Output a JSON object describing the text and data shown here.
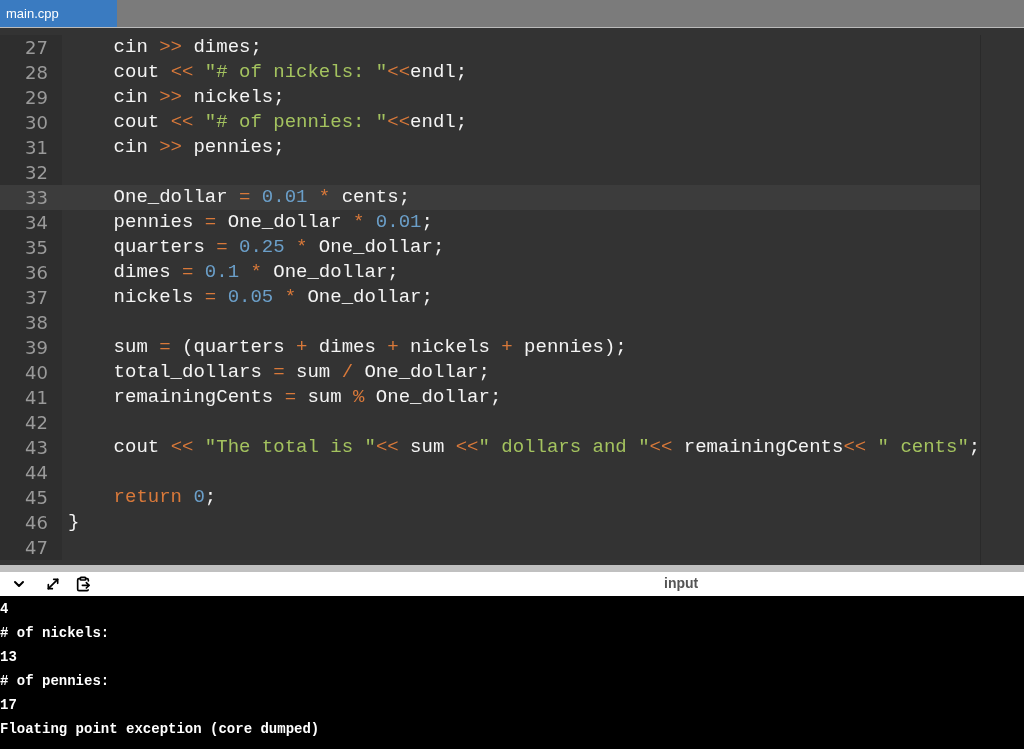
{
  "tabs": [
    {
      "label": "main.cpp",
      "selected": true
    }
  ],
  "code_lines": [
    {
      "number": "27",
      "highlighted": false,
      "tokens": [
        {
          "kind": "plain",
          "text": "    cin "
        },
        {
          "kind": "op",
          "text": ">>"
        },
        {
          "kind": "plain",
          "text": " dimes;"
        }
      ]
    },
    {
      "number": "28",
      "highlighted": false,
      "tokens": [
        {
          "kind": "plain",
          "text": "    cout "
        },
        {
          "kind": "op",
          "text": "<<"
        },
        {
          "kind": "str",
          "text": " \"# of nickels: \""
        },
        {
          "kind": "op",
          "text": "<<"
        },
        {
          "kind": "plain",
          "text": "endl;"
        }
      ]
    },
    {
      "number": "29",
      "highlighted": false,
      "tokens": [
        {
          "kind": "plain",
          "text": "    cin "
        },
        {
          "kind": "op",
          "text": ">>"
        },
        {
          "kind": "plain",
          "text": " nickels;"
        }
      ]
    },
    {
      "number": "30",
      "highlighted": false,
      "tokens": [
        {
          "kind": "plain",
          "text": "    cout "
        },
        {
          "kind": "op",
          "text": "<<"
        },
        {
          "kind": "str",
          "text": " \"# of pennies: \""
        },
        {
          "kind": "op",
          "text": "<<"
        },
        {
          "kind": "plain",
          "text": "endl;"
        }
      ]
    },
    {
      "number": "31",
      "highlighted": false,
      "tokens": [
        {
          "kind": "plain",
          "text": "    cin "
        },
        {
          "kind": "op",
          "text": ">>"
        },
        {
          "kind": "plain",
          "text": " pennies;"
        }
      ]
    },
    {
      "number": "32",
      "highlighted": false
    },
    {
      "number": "33",
      "highlighted": true,
      "tokens": [
        {
          "kind": "plain",
          "text": "    One_dollar "
        },
        {
          "kind": "op",
          "text": "="
        },
        {
          "kind": "num",
          "text": " 0.01"
        },
        {
          "kind": "op",
          "text": " *"
        },
        {
          "kind": "plain",
          "text": " cents;"
        }
      ]
    },
    {
      "number": "34",
      "highlighted": false,
      "tokens": [
        {
          "kind": "plain",
          "text": "    pennies "
        },
        {
          "kind": "op",
          "text": "="
        },
        {
          "kind": "plain",
          "text": " One_dollar "
        },
        {
          "kind": "op",
          "text": "*"
        },
        {
          "kind": "num",
          "text": " 0.01"
        },
        {
          "kind": "plain",
          "text": ";"
        }
      ]
    },
    {
      "number": "35",
      "highlighted": false,
      "tokens": [
        {
          "kind": "plain",
          "text": "    quarters "
        },
        {
          "kind": "op",
          "text": "="
        },
        {
          "kind": "num",
          "text": " 0.25"
        },
        {
          "kind": "op",
          "text": " *"
        },
        {
          "kind": "plain",
          "text": " One_dollar;"
        }
      ]
    },
    {
      "number": "36",
      "highlighted": false,
      "tokens": [
        {
          "kind": "plain",
          "text": "    dimes "
        },
        {
          "kind": "op",
          "text": "="
        },
        {
          "kind": "num",
          "text": " 0.1"
        },
        {
          "kind": "op",
          "text": " *"
        },
        {
          "kind": "plain",
          "text": " One_dollar;"
        }
      ]
    },
    {
      "number": "37",
      "highlighted": false,
      "tokens": [
        {
          "kind": "plain",
          "text": "    nickels "
        },
        {
          "kind": "op",
          "text": "="
        },
        {
          "kind": "num",
          "text": " 0.05"
        },
        {
          "kind": "op",
          "text": " *"
        },
        {
          "kind": "plain",
          "text": " One_dollar;"
        }
      ]
    },
    {
      "number": "38",
      "highlighted": false
    },
    {
      "number": "39",
      "highlighted": false,
      "tokens": [
        {
          "kind": "plain",
          "text": "    sum "
        },
        {
          "kind": "op",
          "text": "="
        },
        {
          "kind": "plain",
          "text": " (quarters "
        },
        {
          "kind": "op",
          "text": "+"
        },
        {
          "kind": "plain",
          "text": " dimes "
        },
        {
          "kind": "op",
          "text": "+"
        },
        {
          "kind": "plain",
          "text": " nickels "
        },
        {
          "kind": "op",
          "text": "+"
        },
        {
          "kind": "plain",
          "text": " pennies);"
        }
      ]
    },
    {
      "number": "40",
      "highlighted": false,
      "tokens": [
        {
          "kind": "plain",
          "text": "    total_dollars "
        },
        {
          "kind": "op",
          "text": "="
        },
        {
          "kind": "plain",
          "text": " sum "
        },
        {
          "kind": "op",
          "text": "/"
        },
        {
          "kind": "plain",
          "text": " One_dollar;"
        }
      ]
    },
    {
      "number": "41",
      "highlighted": false,
      "tokens": [
        {
          "kind": "plain",
          "text": "    remainingCents "
        },
        {
          "kind": "op",
          "text": "="
        },
        {
          "kind": "plain",
          "text": " sum "
        },
        {
          "kind": "op",
          "text": "%"
        },
        {
          "kind": "plain",
          "text": " One_dollar;"
        }
      ]
    },
    {
      "number": "42",
      "highlighted": false
    },
    {
      "number": "43",
      "highlighted": false,
      "tokens": [
        {
          "kind": "plain",
          "text": "    cout "
        },
        {
          "kind": "op",
          "text": "<<"
        },
        {
          "kind": "str",
          "text": " \"The total is \""
        },
        {
          "kind": "op",
          "text": "<<"
        },
        {
          "kind": "plain",
          "text": " sum "
        },
        {
          "kind": "op",
          "text": "<<"
        },
        {
          "kind": "str",
          "text": "\" dollars and \""
        },
        {
          "kind": "op",
          "text": "<<"
        },
        {
          "kind": "plain",
          "text": " remainingCents"
        },
        {
          "kind": "op",
          "text": "<<"
        },
        {
          "kind": "str",
          "text": " \" cents\""
        },
        {
          "kind": "plain",
          "text": ";"
        }
      ]
    },
    {
      "number": "44",
      "highlighted": false
    },
    {
      "number": "45",
      "highlighted": false,
      "tokens": [
        {
          "kind": "kw",
          "text": "    return"
        },
        {
          "kind": "num",
          "text": " 0"
        },
        {
          "kind": "plain",
          "text": ";"
        }
      ]
    },
    {
      "number": "46",
      "highlighted": false,
      "tokens": [
        {
          "kind": "plain",
          "text": "}"
        }
      ]
    },
    {
      "number": "47",
      "highlighted": false
    }
  ],
  "output_panel": {
    "title": "input",
    "lines": [
      "4",
      "# of nickels:",
      "13",
      "# of pennies:",
      "17",
      "Floating point exception (core dumped)"
    ]
  }
}
